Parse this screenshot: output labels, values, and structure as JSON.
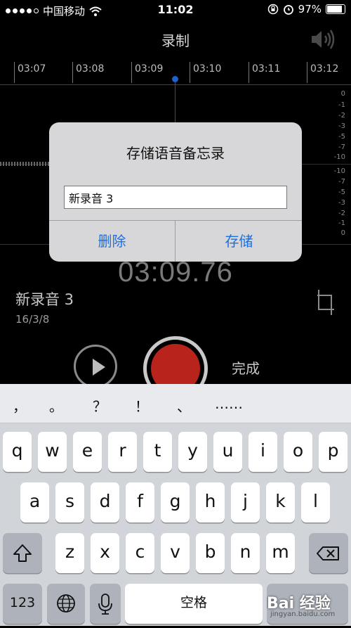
{
  "status_bar": {
    "carrier": "中国移动",
    "time": "11:02",
    "battery": "97%"
  },
  "header": {
    "title": "录制"
  },
  "timeline": {
    "labels": [
      "03:07",
      "03:08",
      "03:09",
      "03:10",
      "03:11",
      "03:12"
    ],
    "db_scale_top": [
      "0",
      "-1",
      "-2",
      "-3",
      "-5",
      "-7",
      "-10"
    ],
    "db_scale_bottom": [
      "-10",
      "-7",
      "-5",
      "-3",
      "-2",
      "-1",
      "0"
    ]
  },
  "recording": {
    "timer": "03:09.76",
    "name": "新录音 3",
    "date": "16/3/8",
    "done_label": "完成"
  },
  "dialog": {
    "title": "存储语音备忘录",
    "input_value": "新录音 3",
    "delete_label": "删除",
    "save_label": "存储"
  },
  "keyboard": {
    "suggestions": [
      "，",
      "。",
      "？",
      "！",
      "、",
      "……"
    ],
    "row1": [
      "q",
      "w",
      "e",
      "r",
      "t",
      "y",
      "u",
      "i",
      "o",
      "p"
    ],
    "row2": [
      "a",
      "s",
      "d",
      "f",
      "g",
      "h",
      "j",
      "k",
      "l"
    ],
    "row3": [
      "z",
      "x",
      "c",
      "v",
      "b",
      "n",
      "m"
    ],
    "num_label": "123",
    "space_label": "空格"
  },
  "watermark": {
    "text": "Bai 经验",
    "url": "jingyan.baidu.com"
  }
}
